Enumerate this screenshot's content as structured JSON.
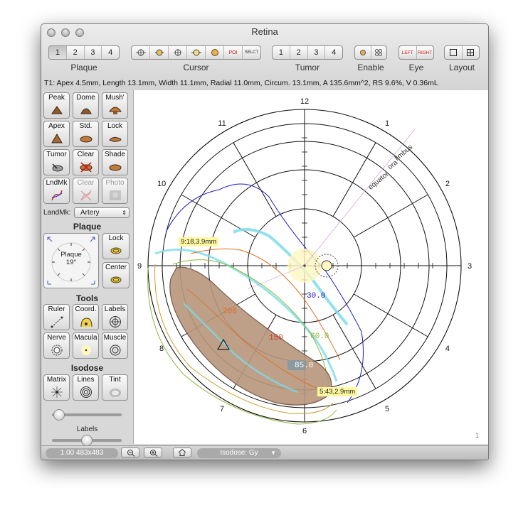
{
  "window": {
    "title": "Retina"
  },
  "toolbar": {
    "plaque": {
      "label": "Plaque",
      "options": [
        "1",
        "2",
        "3",
        "4"
      ],
      "selected": "1"
    },
    "cursor": {
      "label": "Cursor",
      "poi_text": "POI",
      "select_text": "SELCT"
    },
    "tumor": {
      "label": "Tumor",
      "options": [
        "1",
        "2",
        "3",
        "4"
      ]
    },
    "enable": {
      "label": "Enable"
    },
    "eye": {
      "label": "Eye",
      "left": "LEFT",
      "right": "RIGHT"
    },
    "layout": {
      "label": "Layout"
    }
  },
  "status_text": "T1: Apex 4.5mm, Length 13.1mm, Width 11.1mm, Radial 11.0mm, Circum. 13.1mm, A 135.6mm^2, RS 9.6%, V 0.36mL",
  "sidebar": {
    "plaque_tools": [
      {
        "label": "Peak",
        "icon": "peak-plaque-icon"
      },
      {
        "label": "Dome",
        "icon": "dome-plaque-icon"
      },
      {
        "label": "Mush'",
        "icon": "mushroom-plaque-icon"
      },
      {
        "label": "Apex",
        "icon": "apex-icon"
      },
      {
        "label": "Std.",
        "icon": "standard-plaque-icon"
      },
      {
        "label": "Lock",
        "icon": "lock-icon"
      },
      {
        "label": "Tumor",
        "icon": "tumor-icon"
      },
      {
        "label": "Clear",
        "icon": "clear-icon"
      },
      {
        "label": "Shade",
        "icon": "shade-icon"
      },
      {
        "label": "LndMk",
        "icon": "landmark-icon"
      },
      {
        "label": "Clear",
        "icon": "clear-landmark-icon"
      },
      {
        "label": "Photo",
        "icon": "photo-icon"
      }
    ],
    "landmark": {
      "label": "LandMk:",
      "value": "Artery"
    },
    "plaque_section": {
      "title": "Plaque",
      "dial_label": "Plaque",
      "dial_value": "19°",
      "lock_label": "Lock",
      "center_label": "Center"
    },
    "tools_section": {
      "title": "Tools",
      "buttons": [
        {
          "label": "Ruler",
          "icon": "ruler-icon"
        },
        {
          "label": "Coord.",
          "icon": "coordinate-icon"
        },
        {
          "label": "Labels",
          "icon": "labels-icon"
        },
        {
          "label": "Nerve",
          "icon": "nerve-icon"
        },
        {
          "label": "Macula",
          "icon": "macula-icon"
        },
        {
          "label": "Muscle",
          "icon": "muscle-icon"
        }
      ]
    },
    "isodose_section": {
      "title": "Isodose",
      "buttons": [
        {
          "label": "Matrix",
          "icon": "matrix-icon"
        },
        {
          "label": "Lines",
          "icon": "lines-icon"
        },
        {
          "label": "Tint",
          "icon": "tint-icon"
        }
      ],
      "slider1_value": 0.1,
      "labels_label": "Labels",
      "slider2_value": 0.5
    }
  },
  "map": {
    "clock_labels": [
      "12",
      "1",
      "2",
      "3",
      "4",
      "5",
      "6",
      "7",
      "8",
      "9",
      "10",
      "11"
    ],
    "ring_labels": {
      "limbus": "limbus",
      "ora": "ora",
      "equator": "equator"
    },
    "isodose_labels": [
      {
        "text": "30.0",
        "color": "#1a1acc"
      },
      {
        "text": "60.0",
        "color": "#8ab83a"
      },
      {
        "text": "150",
        "color": "#cc3a1a"
      },
      {
        "text": "200",
        "color": "#e06a1a"
      },
      {
        "text": "85.0",
        "color": "#ffffff"
      }
    ],
    "tag1": "9:18,3.9mm",
    "tag2": "5:43,2.9mm",
    "page_number": "1"
  },
  "bottom": {
    "zoom_info": "1.00 483x483",
    "isodose_menu": "Isodose: Gy"
  }
}
